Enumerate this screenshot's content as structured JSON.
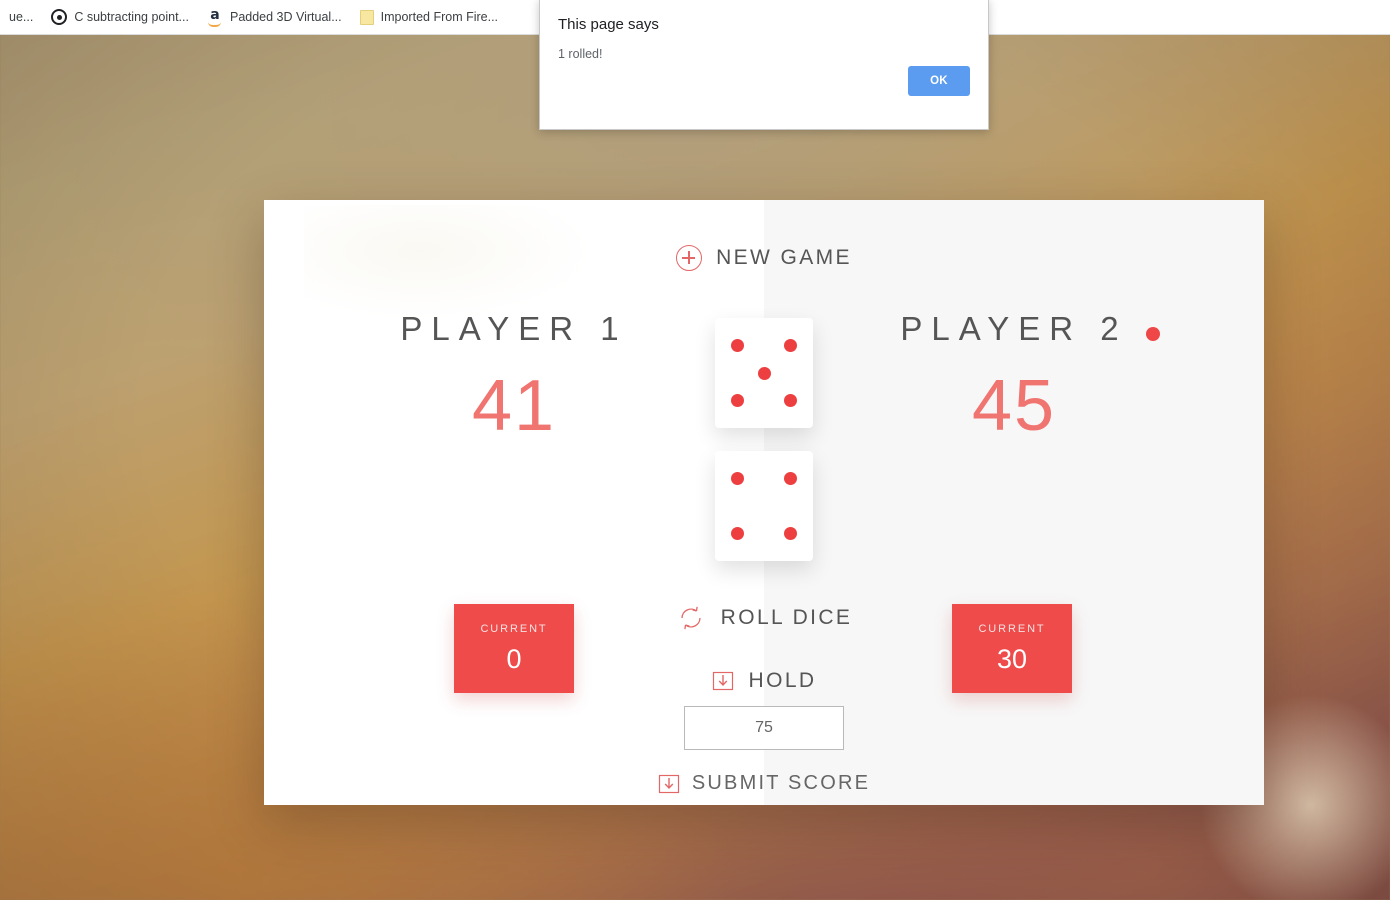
{
  "browser": {
    "bookmarks": [
      {
        "label": "ue...",
        "icon": "none-icon"
      },
      {
        "label": "C subtracting point...",
        "icon": "record-circle-icon"
      },
      {
        "label": "Padded 3D Virtual...",
        "icon": "amazon-icon"
      },
      {
        "label": "Imported From Fire...",
        "icon": "folder-icon"
      }
    ]
  },
  "dialog": {
    "title": "This page says",
    "message": "1 rolled!",
    "ok_label": "OK",
    "ok_color": "#5b9bf0"
  },
  "game": {
    "new_game_label": "NEW GAME",
    "roll_dice_label": "ROLL DICE",
    "hold_label": "HOLD",
    "submit_label": "SUBMIT SCORE",
    "winning_score_value": "75",
    "accent_color": "#ef4b4b",
    "score_color": "#f07470",
    "dice": [
      {
        "value": 5
      },
      {
        "value": 4
      }
    ],
    "players": [
      {
        "name": "PLAYER 1",
        "score": "41",
        "current_label": "CURRENT",
        "current_value": "0",
        "active": false
      },
      {
        "name": "PLAYER 2",
        "score": "45",
        "current_label": "CURRENT",
        "current_value": "30",
        "active": true
      }
    ]
  }
}
